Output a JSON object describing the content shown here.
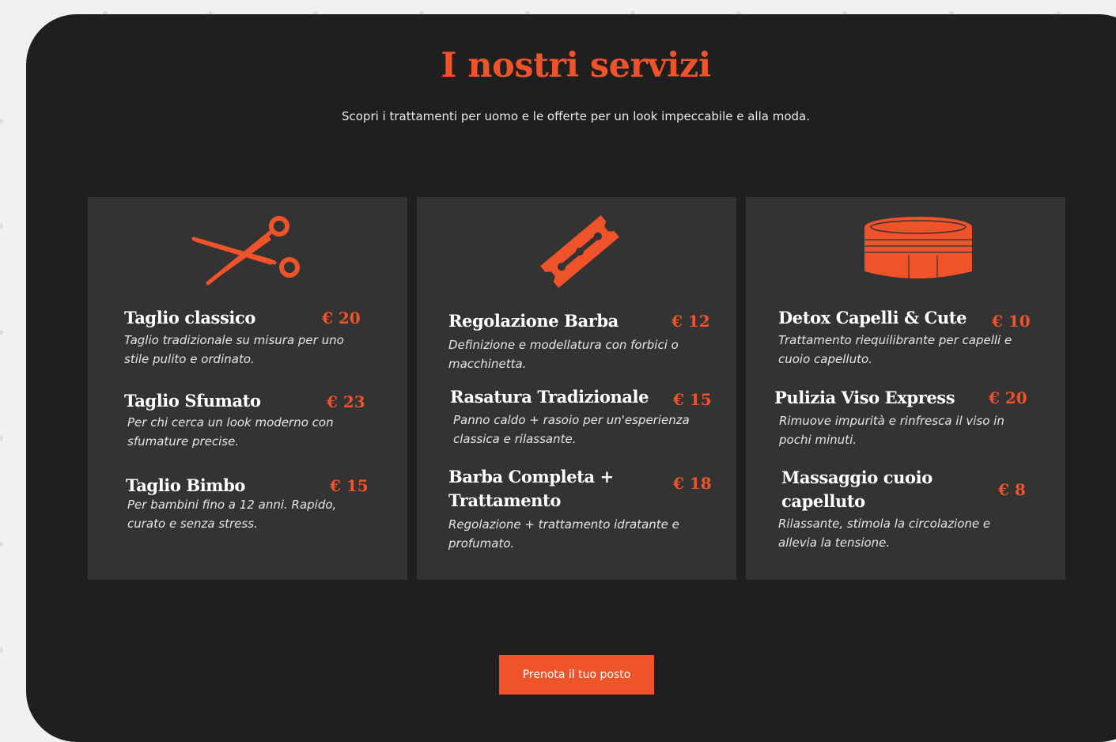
{
  "section": {
    "title": "I nostri servizi",
    "subtitle": "Scopri i trattamenti per uomo e le offerte per un look impeccabile e alla moda."
  },
  "cards": [
    {
      "icon": "scissors-icon",
      "services": [
        {
          "name": "Taglio classico",
          "price": "€ 20",
          "description": "Taglio tradizionale su misura per uno stile pulito e ordinato."
        },
        {
          "name": "Taglio Sfumato",
          "price": "€ 23",
          "description": "Per chi cerca un look moderno con sfumature precise."
        },
        {
          "name": "Taglio Bimbo",
          "price": "€ 15",
          "description": "Per bambini fino a 12 anni. Rapido, curato e senza stress."
        }
      ]
    },
    {
      "icon": "razor-blade-icon",
      "services": [
        {
          "name": "Regolazione Barba",
          "price": "€ 12",
          "description": "Definizione e modellatura con forbici o macchinetta."
        },
        {
          "name": "Rasatura Tradizionale",
          "price": "€ 15",
          "description": "Panno caldo + rasoio per un'esperienza classica e rilassante."
        },
        {
          "name": "Barba Completa + Trattamento",
          "price": "€ 18",
          "description": "Regolazione + trattamento idratante e profumato."
        }
      ]
    },
    {
      "icon": "pomade-jar-icon",
      "services": [
        {
          "name": "Detox Capelli & Cute",
          "price": "€ 10",
          "description": "Trattamento riequilibrante per capelli e cuoio capelluto."
        },
        {
          "name": "Pulizia Viso Express",
          "price": "€ 20",
          "description": "Rimuove impurità e rinfresca il viso in pochi minuti."
        },
        {
          "name": "Massaggio cuoio capelluto",
          "price": "€ 8",
          "description": "Rilassante, stimola la circolazione e allevia la tensione."
        }
      ]
    }
  ],
  "cta": {
    "label": "Prenota il tuo posto"
  },
  "colors": {
    "accent": "#f0532a",
    "panel_background": "#1f1f1f",
    "card_background": "#333333",
    "page_background": "#f1f1f1"
  }
}
